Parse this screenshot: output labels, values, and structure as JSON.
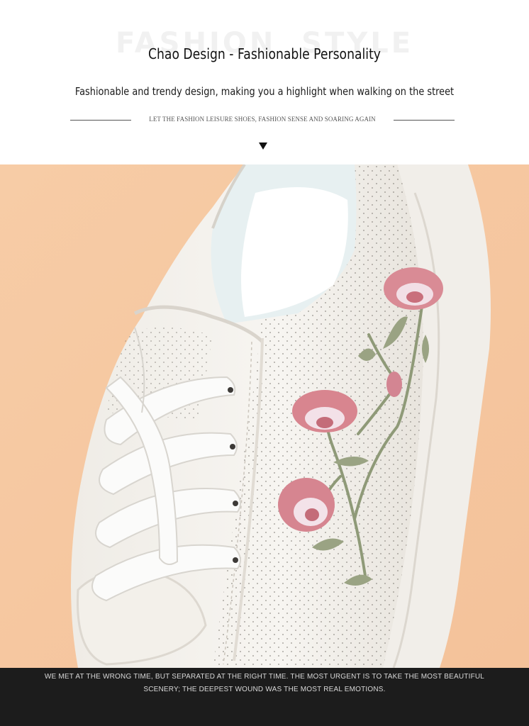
{
  "header": {
    "title": "Chao Design - Fashionable Personality",
    "subtitle": "Fashionable and trendy design, making you a highlight when walking on the street",
    "tagline": "LET THE FASHION LEISURE SHOES, FASHION SENSE AND SOARING AGAIN"
  },
  "footer": {
    "line1": "WE MET AT THE WRONG TIME, BUT SEPARATED AT THE RIGHT TIME. THE MOST URGENT IS TO TAKE THE MOST BEAUTIFUL",
    "line2": "SCENERY; THE DEEPEST WOUND WAS THE MOST REAL EMOTIONS."
  },
  "colors": {
    "background_peach": "#f6c9a0",
    "shoe_white": "#f4f2ee",
    "embroidery_pink": "#d9848f",
    "stem_green": "#8f9a78",
    "footer_bg": "#1c1c1c"
  }
}
